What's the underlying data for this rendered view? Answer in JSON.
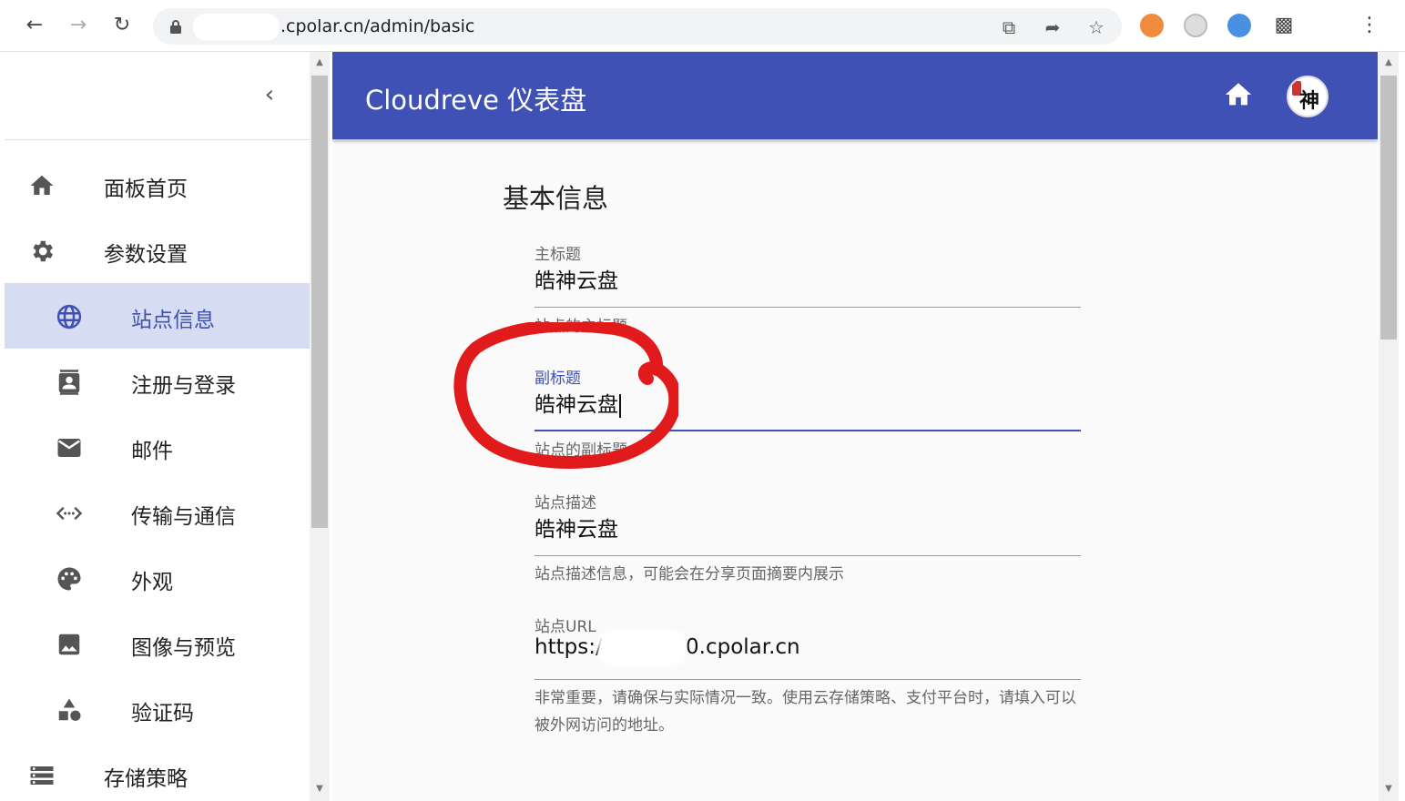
{
  "browser": {
    "url": ".cpolar.cn/admin/basic"
  },
  "appbar": {
    "title": "Cloudreve 仪表盘",
    "avatar_text": "神"
  },
  "sidebar": {
    "items": [
      {
        "label": "面板首页",
        "icon": "home-icon"
      },
      {
        "label": "参数设置",
        "icon": "gear-icon"
      },
      {
        "label": "站点信息",
        "icon": "globe-icon"
      },
      {
        "label": "注册与登录",
        "icon": "contact-icon"
      },
      {
        "label": "邮件",
        "icon": "mail-icon"
      },
      {
        "label": "传输与通信",
        "icon": "code-icon"
      },
      {
        "label": "外观",
        "icon": "palette-icon"
      },
      {
        "label": "图像与预览",
        "icon": "image-icon"
      },
      {
        "label": "验证码",
        "icon": "shapes-icon"
      },
      {
        "label": "存储策略",
        "icon": "storage-icon"
      }
    ]
  },
  "main": {
    "section_title": "基本信息",
    "fields": [
      {
        "label": "主标题",
        "value": "皓神云盘",
        "help": "站点的主标题"
      },
      {
        "label": "副标题",
        "value": "皓神云盘",
        "help": "站点的副标题"
      },
      {
        "label": "站点描述",
        "value": "皓神云盘",
        "help": "站点描述信息，可能会在分享页面摘要内展示"
      },
      {
        "label": "站点URL",
        "value_prefix": "https:/",
        "value_suffix": "0.cpolar.cn",
        "help": "非常重要，请确保与实际情况一致。使用云存储策略、支付平台时，请填入可以被外网访问的地址。"
      }
    ]
  },
  "colors": {
    "primary": "#3f51b5",
    "active_bg": "#d6dcf1",
    "annotation": "#e11b1b"
  }
}
